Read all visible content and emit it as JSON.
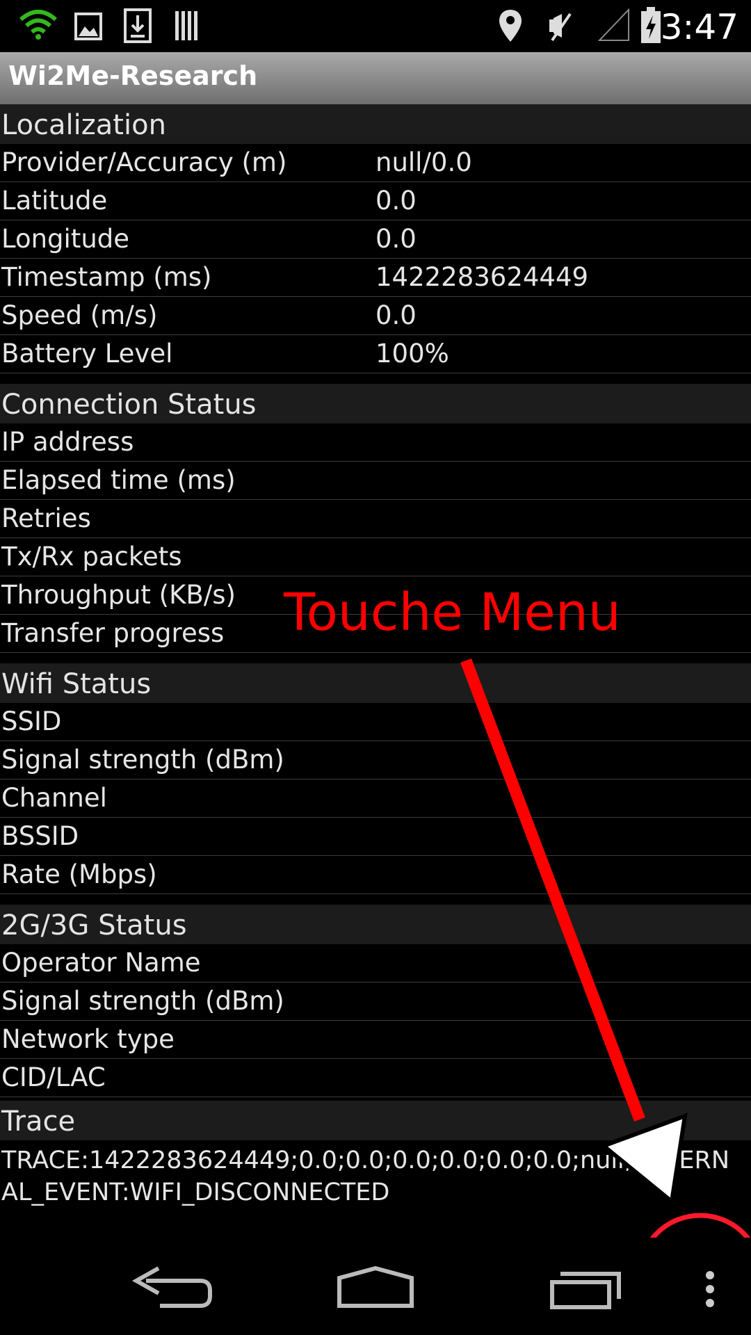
{
  "status_bar": {
    "time": "3:47",
    "icons": [
      "wifi-icon",
      "image-icon",
      "download-icon",
      "barcode-icon",
      "location-icon",
      "mute-icon",
      "signal-icon",
      "battery-charging-icon"
    ]
  },
  "app": {
    "title": "Wi2Me-Research"
  },
  "sections": {
    "localization": {
      "title": "Localization",
      "rows": [
        {
          "label": "Provider/Accuracy (m)",
          "value": "null/0.0"
        },
        {
          "label": "Latitude",
          "value": "0.0"
        },
        {
          "label": "Longitude",
          "value": "0.0"
        },
        {
          "label": "Timestamp (ms)",
          "value": "1422283624449"
        },
        {
          "label": "Speed (m/s)",
          "value": "0.0"
        },
        {
          "label": "Battery Level",
          "value": "100%"
        }
      ]
    },
    "connection": {
      "title": "Connection Status",
      "rows": [
        {
          "label": "IP address",
          "value": ""
        },
        {
          "label": "Elapsed time (ms)",
          "value": ""
        },
        {
          "label": "Retries",
          "value": ""
        },
        {
          "label": "Tx/Rx packets",
          "value": ""
        },
        {
          "label": "Throughput (KB/s)",
          "value": ""
        },
        {
          "label": "Transfer progress",
          "value": ""
        }
      ]
    },
    "wifi": {
      "title": "Wifi Status",
      "rows": [
        {
          "label": "SSID",
          "value": ""
        },
        {
          "label": "Signal strength (dBm)",
          "value": ""
        },
        {
          "label": "Channel",
          "value": ""
        },
        {
          "label": "BSSID",
          "value": ""
        },
        {
          "label": "Rate (Mbps)",
          "value": ""
        }
      ]
    },
    "cellular": {
      "title": "2G/3G Status",
      "rows": [
        {
          "label": "Operator Name",
          "value": ""
        },
        {
          "label": "Signal strength (dBm)",
          "value": ""
        },
        {
          "label": "Network type",
          "value": ""
        },
        {
          "label": "CID/LAC",
          "value": ""
        }
      ]
    },
    "trace": {
      "title": "Trace",
      "text": "TRACE:1422283624449;0.0;0.0;0.0;0.0;0.0;0.0;null;EXTERNAL_EVENT:WIFI_DISCONNECTED"
    }
  },
  "annotation": {
    "text": "Touche Menu",
    "color": "#ff0000"
  },
  "nav_bar": {
    "buttons": [
      "back-icon",
      "home-icon",
      "recents-icon",
      "overflow-menu-icon"
    ]
  }
}
